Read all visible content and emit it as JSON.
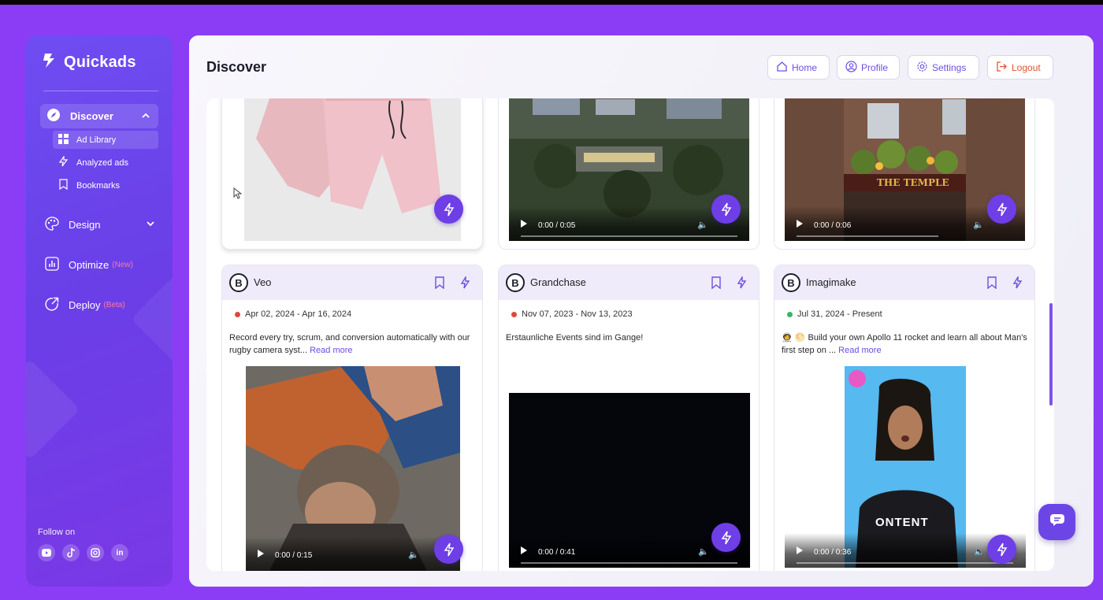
{
  "app": {
    "name": "Quickads"
  },
  "sidebar": {
    "discover_label": "Discover",
    "sub_items": [
      {
        "label": "Ad Library"
      },
      {
        "label": "Analyzed ads"
      },
      {
        "label": "Bookmarks"
      }
    ],
    "design_label": "Design",
    "optimize_label": "Optimize",
    "optimize_tag": "(New)",
    "deploy_label": "Deploy",
    "deploy_tag": "(Beta)",
    "follow_label": "Follow on",
    "socials": [
      "youtube-icon",
      "tiktok-icon",
      "instagram-icon",
      "linkedin-icon"
    ]
  },
  "header": {
    "title": "Discover",
    "home_label": "Home",
    "profile_label": "Profile",
    "settings_label": "Settings",
    "logout_label": "Logout"
  },
  "top_cards": [
    {
      "media": "pink-shorts-image"
    },
    {
      "media": "aerial-campus-video",
      "time": "0:00 / 0:05"
    },
    {
      "media": "pub-exterior-video",
      "time": "0:00 / 0:06",
      "sign_text": "THE TEMPLE"
    }
  ],
  "ads": [
    {
      "brand_initial": "B",
      "brand": "Veo",
      "dates": "Apr 02, 2024 - Apr 16, 2024",
      "status_color": "#e0473a",
      "desc": "Record every try, scrum, and conversion automatically with our rugby camera syst...",
      "read_more": "Read more",
      "time": "0:00 / 0:15"
    },
    {
      "brand_initial": "B",
      "brand": "Grandchase",
      "dates": "Nov 07, 2023 - Nov 13, 2023",
      "status_color": "#e0473a",
      "desc": "Erstaunliche Events sind im Gange!",
      "time": "0:00 / 0:41"
    },
    {
      "brand_initial": "B",
      "brand": "Imagimake",
      "dates": "Jul 31, 2024 - Present",
      "status_color": "#3bb36b",
      "desc": "🧑‍🚀 🌕 Build your own Apollo 11 rocket and learn all about Man's first step on ...",
      "read_more": "Read more",
      "time": "0:00 / 0:36",
      "shirt_text": "ONTENT"
    }
  ],
  "colors": {
    "accent": "#6e3ee6",
    "page_bg": "#8b3df5",
    "logout": "#e2552f"
  }
}
